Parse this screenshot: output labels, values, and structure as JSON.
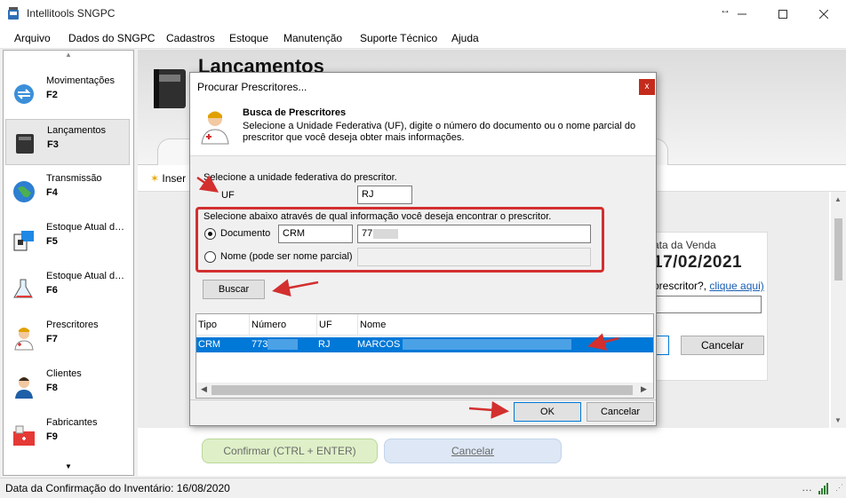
{
  "window": {
    "title": "Intellitools SNGPC",
    "accent": "#0078d7"
  },
  "menu": [
    "Arquivo",
    "Dados do SNGPC",
    "Cadastros",
    "Estoque",
    "Manutenção",
    "Suporte Técnico",
    "Ajuda"
  ],
  "sidebar": {
    "items": [
      {
        "label": "Movimentações",
        "key": "F2",
        "icon": "movements-icon"
      },
      {
        "label": "Lançamentos",
        "key": "F3",
        "icon": "book-icon",
        "active": true
      },
      {
        "label": "Transmissão",
        "key": "F4",
        "icon": "globe-icon"
      },
      {
        "label": "Estoque Atual d…",
        "key": "F5",
        "icon": "stock-icon"
      },
      {
        "label": "Estoque Atual d…",
        "key": "F6",
        "icon": "flask-icon"
      },
      {
        "label": "Prescritores",
        "key": "F7",
        "icon": "doctor-icon"
      },
      {
        "label": "Clientes",
        "key": "F8",
        "icon": "client-icon"
      },
      {
        "label": "Fabricantes",
        "key": "F9",
        "icon": "factory-icon"
      }
    ]
  },
  "main": {
    "title": "Lançamentos",
    "insert_label": "Inser",
    "date_label": "ata da Venda",
    "date_value": "17/02/2021",
    "prescriber_text": "prescritor?, ",
    "prescriber_link": "clique aqui)",
    "cancel_label": "Cancelar",
    "confirm_label": "Confirmar (CTRL + ENTER)",
    "cancel_bottom_label": "Cancelar"
  },
  "status": {
    "text": "Data da Confirmação do Inventário: 16/08/2020"
  },
  "dialog": {
    "title": "Procurar Prescritores...",
    "close": "x",
    "header_title": "Busca de Prescritores",
    "header_desc": "Selecione a Unidade Federativa (UF), digite o número do documento ou o nome parcial do prescritor que você deseja obter mais informações.",
    "uf_prompt": "Selecione a unidade federativa do prescritor.",
    "uf_label": "UF",
    "uf_value": "RJ",
    "search_prompt": "Selecione abaixo através de qual informação você deseja encontrar o prescritor.",
    "radio_document": "Documento",
    "radio_name": "Nome (pode ser nome parcial)",
    "doc_type": "CRM",
    "doc_number": "77",
    "search_button": "Buscar",
    "grid": {
      "columns": [
        "Tipo",
        "Número",
        "UF",
        "Nome"
      ],
      "rows": [
        {
          "tipo": "CRM",
          "numero": "773",
          "uf": "RJ",
          "nome": "MARCOS"
        }
      ]
    },
    "ok_label": "OK",
    "cancel_label": "Cancelar"
  }
}
